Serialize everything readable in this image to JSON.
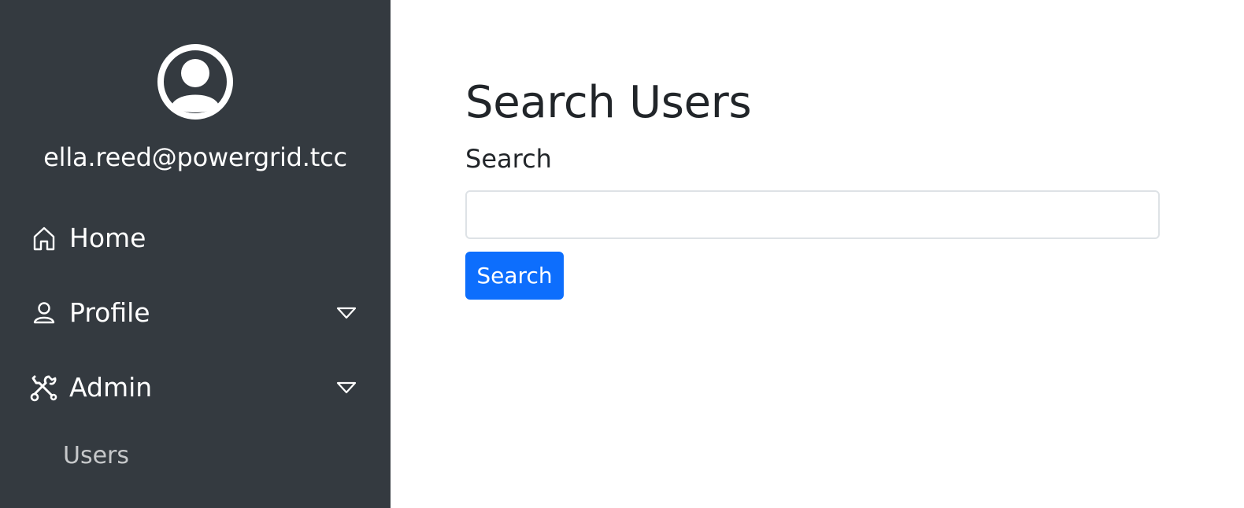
{
  "sidebar": {
    "avatar_icon": "person-circle-icon",
    "user_email": "ella.reed@powergrid.tcc",
    "items": [
      {
        "label": "Home",
        "icon": "house-icon",
        "has_caret": false
      },
      {
        "label": "Profile",
        "icon": "person-icon",
        "has_caret": true
      },
      {
        "label": "Admin",
        "icon": "tools-icon",
        "has_caret": true
      }
    ],
    "sub_items": [
      {
        "label": "Users"
      }
    ],
    "background_color": "#343a40"
  },
  "main": {
    "title": "Search Users",
    "search": {
      "label": "Search",
      "value": "",
      "placeholder": ""
    },
    "search_button_label": "Search",
    "accent_color": "#0d6efd"
  }
}
